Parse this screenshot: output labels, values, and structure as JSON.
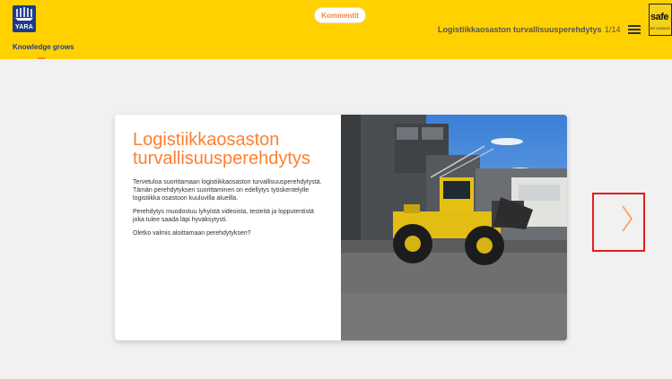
{
  "header": {
    "logo_text": "YARA",
    "tagline": "Knowledge grows",
    "comment_button": "Kommentit",
    "course_title": "Logistiikkaosaston turvallisuusperehdytys",
    "page_counter": "1/14",
    "badge_text": "safe",
    "badge_subtext": "BY CHOICE"
  },
  "slide": {
    "title": "Logistiikkaosaston turvallisuusperehdytys",
    "paragraphs": [
      "Tervetuloa suorittamaan logistiikkaosaston turvallisuusperehdytystä. Tämän perehdytyksen suorittaminen on edellytys työskentelylle logistiikka osastoon kuuluvilla alueilla.",
      "Perehdytys muodostuu lyhyistä videoista, testeitä ja lopputentistä joka tulee saada läpi hyväksytysti.",
      "Oletko valmis aloittamaan perehdytyksen?"
    ],
    "image_icon": "wheel-loader-photo"
  },
  "navigation": {
    "next_icon": "chevron-right-icon"
  },
  "colors": {
    "header_bg": "#ffd100",
    "brand_blue": "#1e3c8c",
    "accent_orange": "#ff7f32",
    "highlight_red": "#e41e1e"
  }
}
